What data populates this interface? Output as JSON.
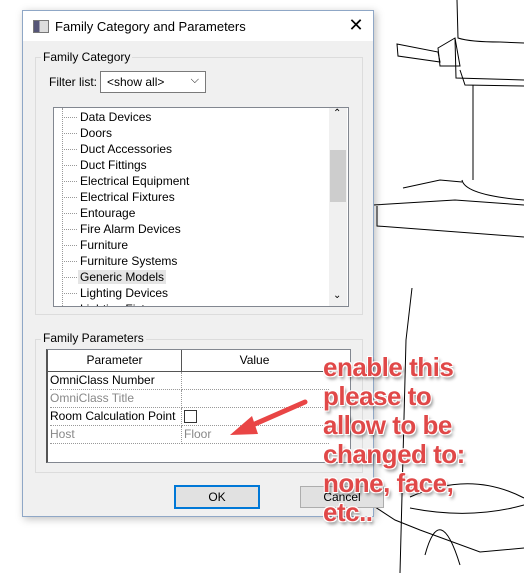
{
  "dialog": {
    "title": "Family Category and Parameters",
    "close_icon": "close-icon"
  },
  "category": {
    "group_label": "Family Category",
    "filter_label": "Filter list:",
    "filter_value": "<show all>",
    "items": [
      "Data Devices",
      "Doors",
      "Duct Accessories",
      "Duct Fittings",
      "Electrical Equipment",
      "Electrical Fixtures",
      "Entourage",
      "Fire Alarm Devices",
      "Furniture",
      "Furniture Systems",
      "Generic Models",
      "Lighting Devices",
      "Lighting Fixtures"
    ],
    "selected": "Generic Models"
  },
  "parameters": {
    "group_label": "Family Parameters",
    "headers": [
      "Parameter",
      "Value"
    ],
    "rows": [
      {
        "name": "OmniClass Number",
        "value": "",
        "enabled": true
      },
      {
        "name": "OmniClass Title",
        "value": "",
        "enabled": false
      },
      {
        "name": "Room Calculation Point",
        "value": "checkbox-unchecked",
        "enabled": true
      },
      {
        "name": "Host",
        "value": "Floor",
        "enabled": false
      }
    ]
  },
  "buttons": {
    "ok": "OK",
    "cancel": "Cancel"
  },
  "annotation": {
    "lines": [
      "enable this",
      "please to",
      "allow to be",
      "changed to:",
      "none, face,",
      "etc.."
    ],
    "color": "#e04848"
  }
}
